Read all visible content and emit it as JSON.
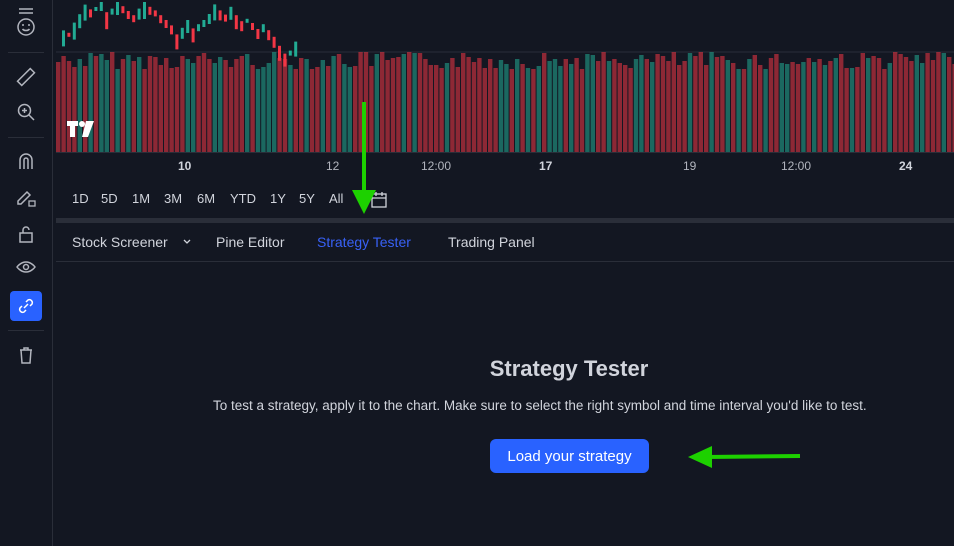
{
  "colors": {
    "accent": "#2962ff",
    "up": "#22ab94",
    "down": "#f23645",
    "arrow": "#1dd100"
  },
  "sidebar": {
    "icons": [
      "menu-icon",
      "emoji-icon",
      "ruler-icon",
      "zoom-in-icon",
      "magnet-icon",
      "pencil-lock-icon",
      "lock-icon",
      "eye-icon",
      "link-icon",
      "trash-icon"
    ]
  },
  "time_axis": {
    "ticks": [
      "10",
      "12",
      "12:00",
      "17",
      "19",
      "12:00",
      "24"
    ],
    "bold": [
      "10",
      "17",
      "24"
    ]
  },
  "range_bar": {
    "buttons": [
      "1D",
      "5D",
      "1M",
      "3M",
      "6M",
      "YTD",
      "1Y",
      "5Y",
      "All"
    ]
  },
  "tabs": {
    "screener": "Stock Screener",
    "pine": "Pine Editor",
    "tester": "Strategy Tester",
    "trading": "Trading Panel",
    "active": "Strategy Tester"
  },
  "strategy_tester": {
    "title": "Strategy Tester",
    "description": "To test a strategy, apply it to the chart. Make sure to select the right symbol and time interval you'd like to test.",
    "load_button": "Load your strategy"
  }
}
